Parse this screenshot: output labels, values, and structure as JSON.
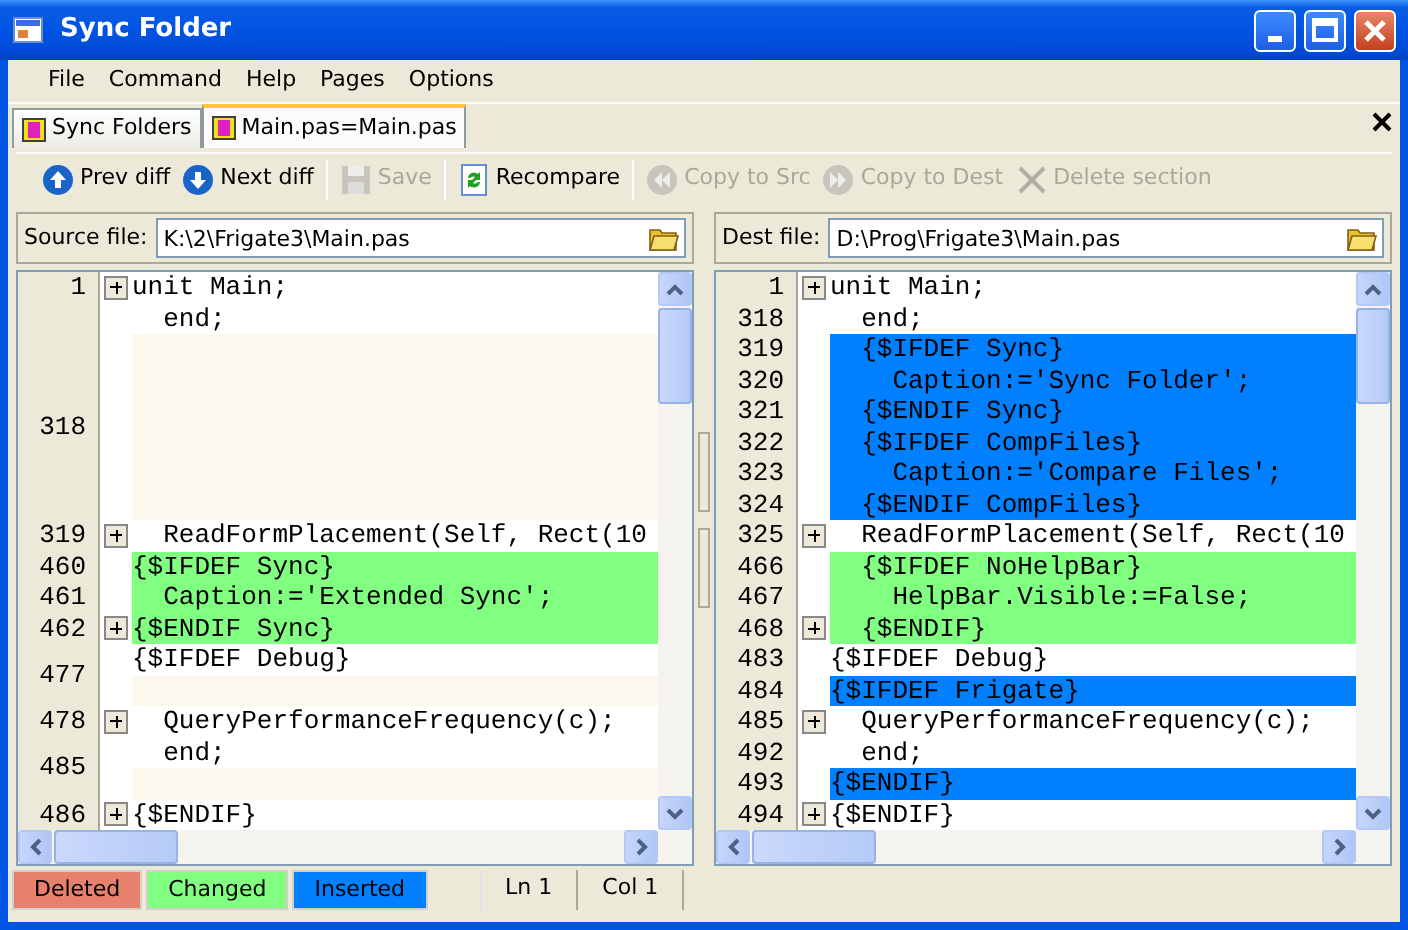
{
  "window": {
    "title": "Sync Folder"
  },
  "menu": [
    "File",
    "Command",
    "Help",
    "Pages",
    "Options"
  ],
  "tabs": [
    {
      "label": "Sync Folders",
      "selected": false
    },
    {
      "label": "Main.pas=Main.pas",
      "selected": true
    }
  ],
  "toolbar": [
    {
      "kind": "prev",
      "label": "Prev diff",
      "disabled": false
    },
    {
      "kind": "next",
      "label": "Next diff",
      "disabled": false
    },
    {
      "kind": "save",
      "label": "Save",
      "disabled": true
    },
    {
      "kind": "recompare",
      "label": "Recompare",
      "disabled": false
    },
    {
      "kind": "copy-src",
      "label": "Copy to Src",
      "disabled": true
    },
    {
      "kind": "copy-dest",
      "label": "Copy to Dest",
      "disabled": true
    },
    {
      "kind": "delete",
      "label": "Delete section",
      "disabled": true
    }
  ],
  "panes": [
    {
      "label": "Source file:",
      "value": "K:\\2\\Frigate3\\Main.pas",
      "groups": [
        {
          "number": "1",
          "fold": true,
          "lines": [
            {
              "kind": "normal",
              "text": "unit Main;"
            }
          ]
        },
        {
          "fold": false,
          "lines": [
            {
              "kind": "normal",
              "text": "  end;"
            }
          ]
        },
        {
          "number": "318",
          "fold": false,
          "lines": [
            {
              "kind": "blank"
            },
            {
              "kind": "blank"
            },
            {
              "kind": "blank"
            },
            {
              "kind": "blank"
            },
            {
              "kind": "blank"
            },
            {
              "kind": "blank"
            }
          ]
        },
        {
          "number": "319",
          "fold": true,
          "lines": [
            {
              "kind": "normal",
              "text": "  ReadFormPlacement(Self, Rect(10"
            }
          ]
        },
        {
          "number": "460",
          "fold": false,
          "lines": [
            {
              "kind": "changed",
              "text": "{$IFDEF Sync}"
            }
          ]
        },
        {
          "number": "461",
          "fold": false,
          "lines": [
            {
              "kind": "changed",
              "text": "  Caption:='Extended Sync';"
            }
          ]
        },
        {
          "number": "462",
          "fold": true,
          "lines": [
            {
              "kind": "changed",
              "text": "{$ENDIF Sync}"
            }
          ]
        },
        {
          "number": "477",
          "fold": false,
          "lines": [
            {
              "kind": "normal",
              "text": "{$IFDEF Debug}"
            },
            {
              "kind": "blank"
            }
          ]
        },
        {
          "number": "478",
          "fold": true,
          "lines": [
            {
              "kind": "normal",
              "text": "  QueryPerformanceFrequency(c);"
            }
          ]
        },
        {
          "number": "485",
          "fold": false,
          "lines": [
            {
              "kind": "normal",
              "text": "  end;"
            },
            {
              "kind": "blank"
            }
          ]
        },
        {
          "number": "486",
          "fold": true,
          "lines": [
            {
              "kind": "normal",
              "text": "{$ENDIF}"
            }
          ]
        }
      ]
    },
    {
      "label": "Dest file:",
      "value": "D:\\Prog\\Frigate3\\Main.pas",
      "groups": [
        {
          "number": "1",
          "fold": true,
          "lines": [
            {
              "kind": "normal",
              "text": "unit Main;"
            }
          ]
        },
        {
          "number": "318",
          "fold": false,
          "lines": [
            {
              "kind": "normal",
              "text": "  end;"
            }
          ]
        },
        {
          "number": "319",
          "fold": false,
          "lines": [
            {
              "kind": "inserted",
              "text": "  {$IFDEF Sync}"
            }
          ]
        },
        {
          "number": "320",
          "fold": false,
          "lines": [
            {
              "kind": "inserted",
              "text": "    Caption:='Sync Folder';"
            }
          ]
        },
        {
          "number": "321",
          "fold": false,
          "lines": [
            {
              "kind": "inserted",
              "text": "  {$ENDIF Sync}"
            }
          ]
        },
        {
          "number": "322",
          "fold": false,
          "lines": [
            {
              "kind": "inserted",
              "text": "  {$IFDEF CompFiles}"
            }
          ]
        },
        {
          "number": "323",
          "fold": false,
          "lines": [
            {
              "kind": "inserted",
              "text": "    Caption:='Compare Files';"
            }
          ]
        },
        {
          "number": "324",
          "fold": false,
          "lines": [
            {
              "kind": "inserted",
              "text": "  {$ENDIF CompFiles}"
            }
          ]
        },
        {
          "number": "325",
          "fold": true,
          "lines": [
            {
              "kind": "normal",
              "text": "  ReadFormPlacement(Self, Rect(10"
            }
          ]
        },
        {
          "number": "466",
          "fold": false,
          "lines": [
            {
              "kind": "changed",
              "text": "  {$IFDEF NoHelpBar}"
            }
          ]
        },
        {
          "number": "467",
          "fold": false,
          "lines": [
            {
              "kind": "changed",
              "text": "    HelpBar.Visible:=False;"
            }
          ]
        },
        {
          "number": "468",
          "fold": true,
          "lines": [
            {
              "kind": "changed",
              "text": "  {$ENDIF}"
            }
          ]
        },
        {
          "number": "483",
          "fold": false,
          "lines": [
            {
              "kind": "normal",
              "text": "{$IFDEF Debug}"
            }
          ]
        },
        {
          "number": "484",
          "fold": false,
          "lines": [
            {
              "kind": "inserted",
              "text": "{$IFDEF Frigate}"
            }
          ]
        },
        {
          "number": "485",
          "fold": true,
          "lines": [
            {
              "kind": "normal",
              "text": "  QueryPerformanceFrequency(c);"
            }
          ]
        },
        {
          "number": "492",
          "fold": false,
          "lines": [
            {
              "kind": "normal",
              "text": "  end;"
            }
          ]
        },
        {
          "number": "493",
          "fold": false,
          "lines": [
            {
              "kind": "inserted",
              "text": "{$ENDIF}"
            }
          ]
        },
        {
          "number": "494",
          "fold": true,
          "lines": [
            {
              "kind": "normal",
              "text": "{$ENDIF}"
            }
          ]
        }
      ]
    }
  ],
  "legend": [
    {
      "label": "Deleted",
      "color": "#e8806e"
    },
    {
      "label": "Changed",
      "color": "#80ff80"
    },
    {
      "label": "Inserted",
      "color": "#0080ff"
    }
  ],
  "status": {
    "line": "Ln 1",
    "column": "Col 1"
  }
}
